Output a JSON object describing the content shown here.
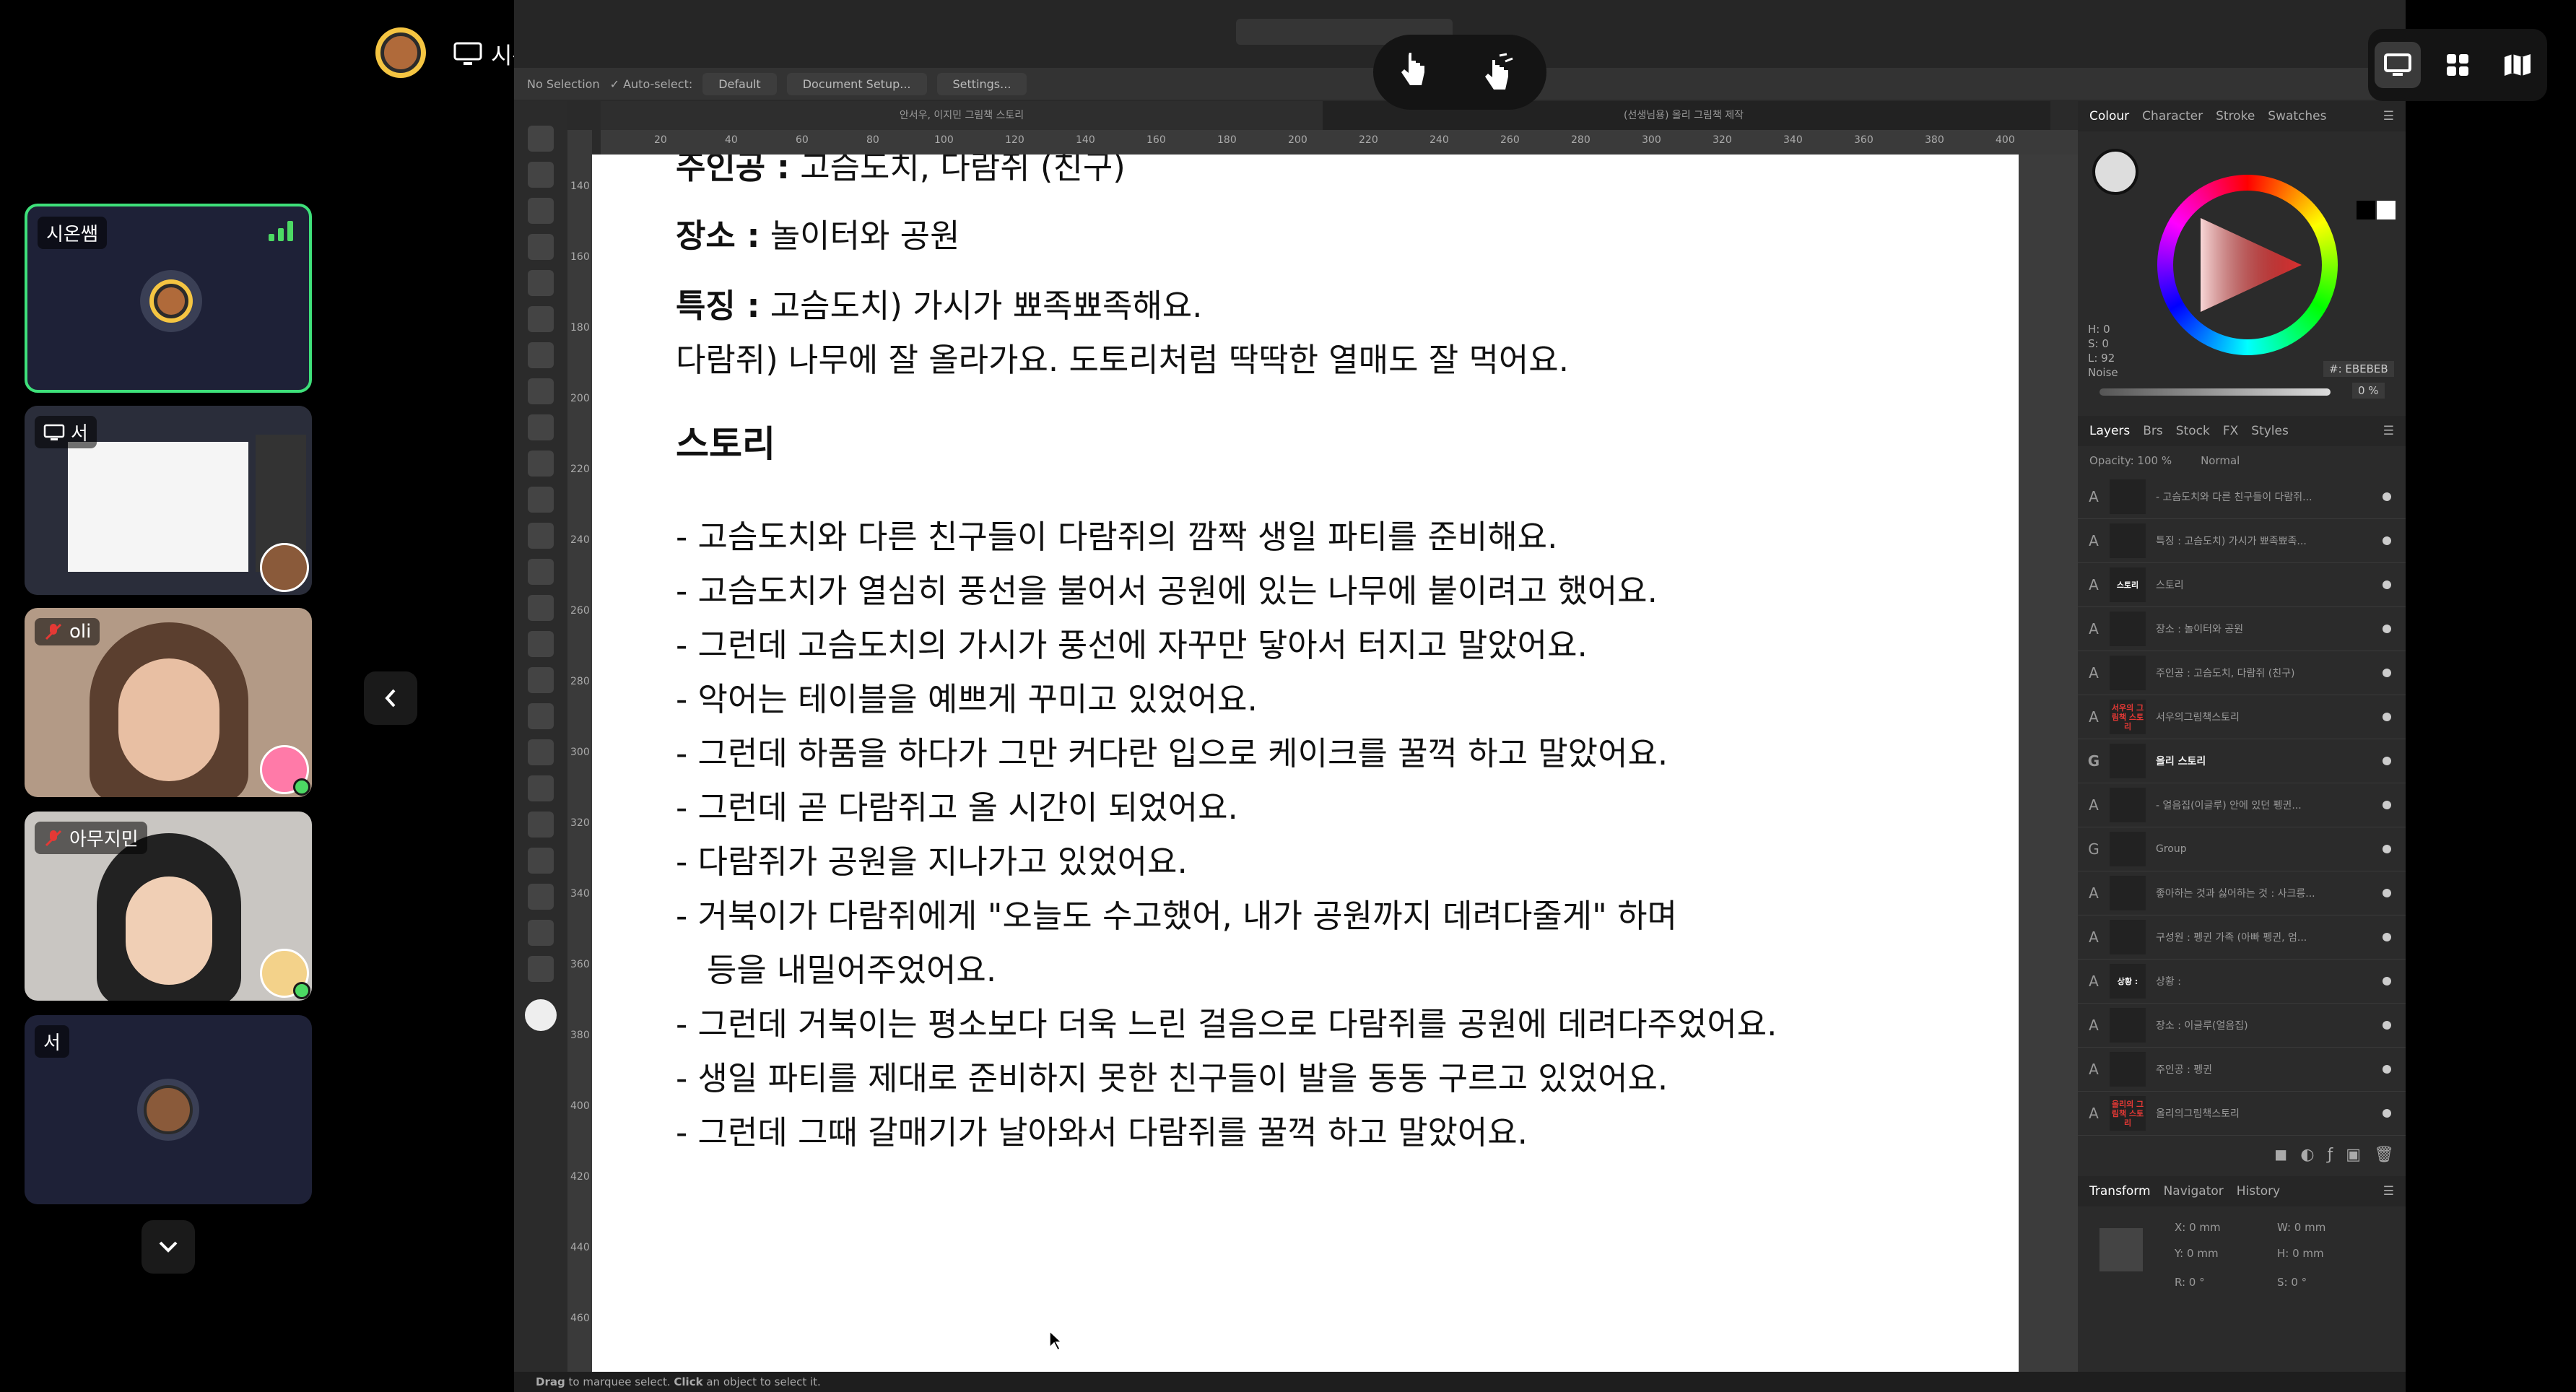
{
  "top": {
    "presenter_name": "시온쌤"
  },
  "participants": [
    {
      "name": "시온쌤",
      "muted": false
    },
    {
      "name": "서",
      "sharing": true
    },
    {
      "name": "oli",
      "muted": true
    },
    {
      "name": "아무지민",
      "muted": true
    },
    {
      "name": "서",
      "muted": false
    }
  ],
  "app": {
    "context_bar": {
      "selection": "No Selection",
      "auto_select": "Auto-select:",
      "auto_select_value": "Default",
      "doc_setup": "Document Setup...",
      "settings": "Settings..."
    },
    "tabs": [
      "안서우, 이지민 그림책 스토리",
      "(선생님용) 올리 그림책 제작"
    ],
    "ruler_h": [
      "20",
      "40",
      "60",
      "80",
      "100",
      "120",
      "140",
      "160",
      "180",
      "200",
      "220",
      "240",
      "260",
      "280",
      "300",
      "320",
      "340",
      "360",
      "380",
      "400"
    ],
    "ruler_v": [
      "140",
      "160",
      "180",
      "200",
      "220",
      "240",
      "260",
      "280",
      "300",
      "320",
      "340",
      "360",
      "380",
      "400",
      "420",
      "440",
      "460"
    ],
    "ruler_unit": "mm",
    "status": {
      "drag": "Drag",
      "to_marquee": "to marquee select.",
      "click": "Click",
      "to_select": "an object to select it."
    }
  },
  "document": {
    "line1_label": "주인공 :",
    "line1_value": "고슴도치, 다람쥐 (친구)",
    "place_label": "장소 :",
    "place_value": "놀이터와 공원",
    "feature_label": "특징 :",
    "feature_value": "고슴도치) 가시가 뾰족뾰족해요.",
    "feature_line2": "다람쥐) 나무에 잘 올라가요. 도토리처럼 딱딱한 열매도 잘 먹어요.",
    "story_heading": "스토리",
    "story": [
      "- 고슴도치와 다른 친구들이 다람쥐의 깜짝 생일 파티를 준비해요.",
      "- 고슴도치가 열심히 풍선을 불어서 공원에 있는 나무에 붙이려고 했어요.",
      "- 그런데 고슴도치의 가시가 풍선에 자꾸만 닿아서 터지고 말았어요.",
      "- 악어는 테이블을 예쁘게 꾸미고 있었어요.",
      "- 그런데 하품을 하다가 그만 커다란 입으로 케이크를 꿀꺽 하고 말았어요.",
      "- 그런데 곧 다람쥐고 올 시간이 되었어요.",
      "- 다람쥐가 공원을 지나가고 있었어요.",
      "- 거북이가 다람쥐에게 \"오늘도 수고했어, 내가 공원까지 데려다줄게\" 하며",
      "   등을 내밀어주었어요.",
      "- 그런데 거북이는 평소보다 더욱 느린 걸음으로 다람쥐를 공원에 데려다주었어요.",
      "- 생일 파티를 제대로 준비하지 못한 친구들이 발을 동동 구르고 있었어요.",
      "- 그런데 그때 갈매기가 날아와서 다람쥐를 꿀꺽 하고 말았어요."
    ]
  },
  "colour_panel": {
    "tabs": [
      "Colour",
      "Character",
      "Stroke",
      "Swatches"
    ],
    "h": "H: 0",
    "s": "S: 0",
    "l": "L: 92",
    "noise": "Noise",
    "hex": "#: EBEBEB",
    "opacity_pct": "0 %",
    "current_color": "#EBEBEB",
    "noise_value": 0
  },
  "layers_panel": {
    "tabs": [
      "Layers",
      "Brs",
      "Stock",
      "FX",
      "Styles"
    ],
    "opacity": "Opacity: 100 %",
    "blend": "Normal",
    "rows": [
      {
        "type": "A",
        "thumb": "",
        "name": "- 고슴도치와 다른 친구들이 다람쥐..."
      },
      {
        "type": "A",
        "thumb": "",
        "name": "특징 : 고슴도치) 가시가 뾰족뾰족..."
      },
      {
        "type": "A",
        "thumb": "스토리",
        "name": "스토리"
      },
      {
        "type": "A",
        "thumb": "",
        "name": "장소 : 놀이터와 공원"
      },
      {
        "type": "A",
        "thumb": "",
        "name": "주인공 : 고슴도치, 다람쥐 (친구)"
      },
      {
        "type": "A",
        "thumb": "서우의 그림책 스토리",
        "name": "서우의그림책스토리"
      },
      {
        "type": "G",
        "thumb": "",
        "name": "올리 스토리"
      },
      {
        "type": "A",
        "thumb": "",
        "name": "- 얼음집(이글루) 안에 있던 펭귄..."
      },
      {
        "type": "G",
        "thumb": "",
        "name": "Group"
      },
      {
        "type": "A",
        "thumb": "",
        "name": "좋아하는 것과 싫어하는 것 : 사크릉..."
      },
      {
        "type": "A",
        "thumb": "",
        "name": "구성원 : 펭귄 가족 (아빠 펭귄, 엄..."
      },
      {
        "type": "A",
        "thumb": "상황 :",
        "name": "상황 :"
      },
      {
        "type": "A",
        "thumb": "",
        "name": "장소 : 이글루(얼음집)"
      },
      {
        "type": "A",
        "thumb": "",
        "name": "주인공 : 펭귄"
      },
      {
        "type": "A",
        "thumb": "올리의 그림책 스토리",
        "name": "올리의그림책스토리"
      }
    ]
  },
  "transform_panel": {
    "tabs": [
      "Transform",
      "Navigator",
      "History"
    ],
    "x": "X:",
    "x_val": "0 mm",
    "y": "Y:",
    "y_val": "0 mm",
    "w": "W:",
    "w_val": "0 mm",
    "h": "H:",
    "h_val": "0 mm",
    "r": "R:",
    "r_val": "0 °",
    "s": "S:",
    "s_val": "0 °"
  }
}
